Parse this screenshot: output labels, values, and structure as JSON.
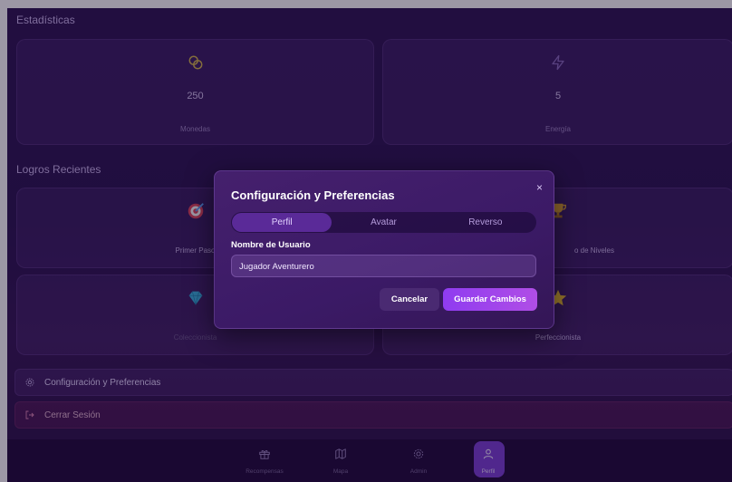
{
  "stats": {
    "title": "Estadísticas",
    "items": [
      {
        "icon": "coins-icon",
        "value": "250",
        "label": "Monedas",
        "color": "#d6b94a"
      },
      {
        "icon": "lightning-icon",
        "value": "5",
        "label": "Energía",
        "color": "#8b6bbf"
      }
    ]
  },
  "achievements": {
    "title": "Logros Recientes",
    "items": [
      {
        "icon": "target-icon",
        "label": "Primer Paso"
      },
      {
        "icon": "trophy-icon",
        "label": "o de Niveles"
      },
      {
        "icon": "diamond-icon",
        "label": "Coleccionista"
      },
      {
        "icon": "star-icon",
        "label": "Perfeccionista"
      }
    ]
  },
  "menu": {
    "settings_label": "Configuración y Preferencias",
    "logout_label": "Cerrar Sesión"
  },
  "dialog": {
    "title": "Configuración y Preferencias",
    "close": "×",
    "tabs": [
      "Perfil",
      "Avatar",
      "Reverso"
    ],
    "active_tab": "Perfil",
    "field_label": "Nombre de Usuario",
    "field_value": "Jugador Aventurero",
    "cancel_label": "Cancelar",
    "save_label": "Guardar Cambios"
  },
  "nav": {
    "items": [
      {
        "icon": "gift-icon",
        "label": "Recompensas"
      },
      {
        "icon": "map-icon",
        "label": "Mapa"
      },
      {
        "icon": "gear-icon",
        "label": "Admin"
      },
      {
        "icon": "user-icon",
        "label": "Perfil"
      }
    ],
    "active": "Perfil"
  },
  "colors": {
    "accent": "#8f3cf0",
    "background": "#2d1452"
  }
}
